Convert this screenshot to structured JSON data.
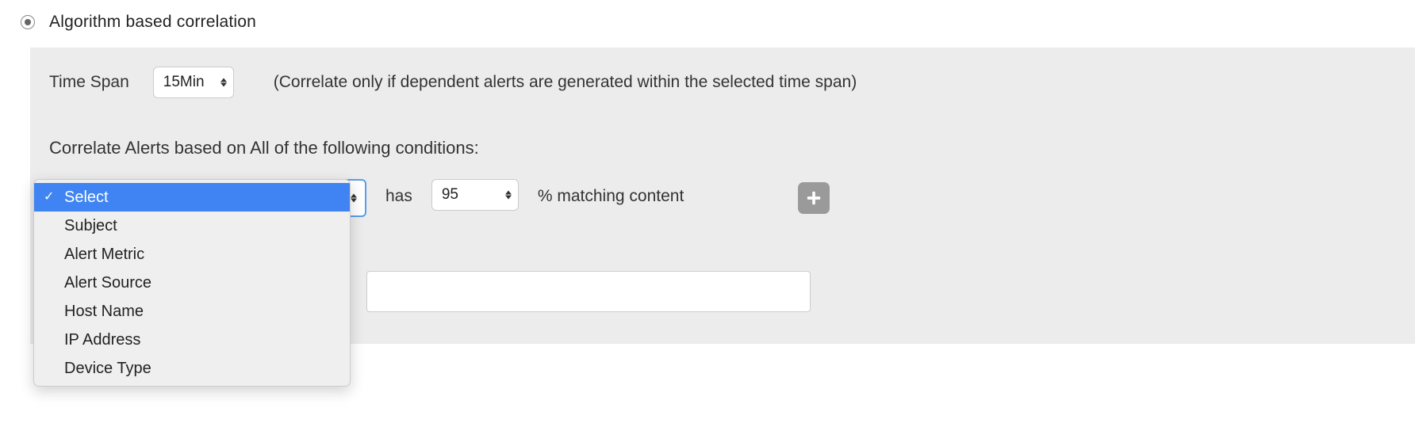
{
  "correlation_type": {
    "label": "Algorithm based correlation",
    "selected": true
  },
  "timespan": {
    "label": "Time Span",
    "value": "15Min",
    "hint": "(Correlate only if dependent alerts are generated within the selected time span)"
  },
  "conditions_header": "Correlate Alerts based on All of the following conditions:",
  "condition_row": {
    "field_select": {
      "selected_value": "Select",
      "options": [
        "Select",
        "Subject",
        "Alert Metric",
        "Alert Source",
        "Host Name",
        "IP Address",
        "Device Type"
      ]
    },
    "operator": "has",
    "percent": "95",
    "suffix": "% matching content"
  }
}
